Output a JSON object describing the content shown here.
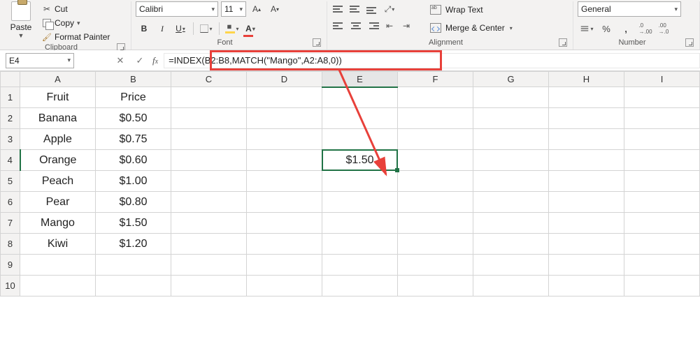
{
  "ribbon": {
    "clipboard": {
      "paste": "Paste",
      "cut": "Cut",
      "copy": "Copy",
      "format_painter": "Format Painter",
      "label": "Clipboard"
    },
    "font": {
      "name": "Calibri",
      "size": "11",
      "bold": "B",
      "italic": "I",
      "underline": "U",
      "letter": "A",
      "label": "Font"
    },
    "alignment": {
      "wrap_text": "Wrap Text",
      "merge_center": "Merge & Center",
      "label": "Alignment"
    },
    "number": {
      "format": "General",
      "percent": "%",
      "comma": ",",
      "label": "Number"
    }
  },
  "name_box": "E4",
  "formula": "=INDEX(B2:B8,MATCH(\"Mango\",A2:A8,0))",
  "columns": [
    "A",
    "B",
    "C",
    "D",
    "E",
    "F",
    "G",
    "H",
    "I"
  ],
  "row_count": 10,
  "active_cell": {
    "col": "E",
    "row": 4
  },
  "cells": {
    "A1": "Fruit",
    "B1": "Price",
    "A2": "Banana",
    "B2": "$0.50",
    "A3": "Apple",
    "B3": "$0.75",
    "A4": "Orange",
    "B4": "$0.60",
    "A5": "Peach",
    "B5": "$1.00",
    "A6": "Pear",
    "B6": "$0.80",
    "A7": "Mango",
    "B7": "$1.50",
    "A8": "Kiwi",
    "B8": "$1.20",
    "E4": "$1.50"
  }
}
